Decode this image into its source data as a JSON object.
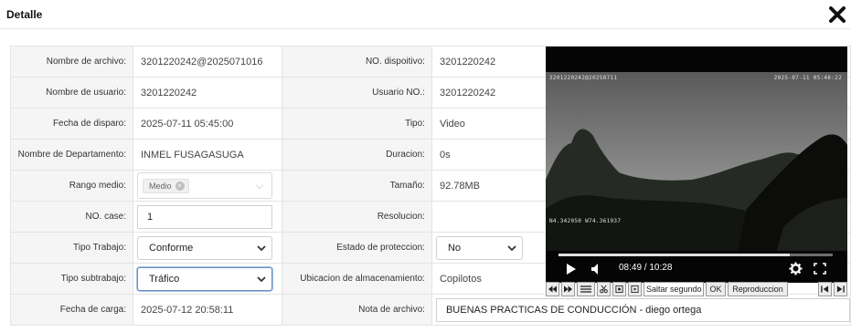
{
  "dialog": {
    "title": "Detalle",
    "close_icon": "close-icon"
  },
  "form": {
    "nombre_archivo": {
      "label": "Nombre de archivo:",
      "value": "3201220242@2025071016"
    },
    "no_dispositivo": {
      "label": "NO. dispoitivo:",
      "value": "3201220242"
    },
    "nombre_usuario": {
      "label": "Nombre de usuario:",
      "value": "3201220242"
    },
    "usuario_no": {
      "label": "Usuario NO.:",
      "value": "3201220242"
    },
    "fecha_disparo": {
      "label": "Fecha de disparo:",
      "value": "2025-07-11 05:45:00"
    },
    "tipo": {
      "label": "Tipo:",
      "value": "Video"
    },
    "nombre_departamento": {
      "label": "Nombre de Departamento:",
      "value": "INMEL FUSAGASUGA"
    },
    "duracion": {
      "label": "Duracion:",
      "value": "0s"
    },
    "rango_medio": {
      "label": "Rango medio:",
      "tag": "Medio"
    },
    "tamano": {
      "label": "Tamaño:",
      "value": "92.78MB"
    },
    "no_case": {
      "label": "NO. case:",
      "value": "1"
    },
    "resolucion": {
      "label": "Resolucion:",
      "value": ""
    },
    "tipo_trabajo": {
      "label": "Tipo Trabajo:",
      "value": "Conforme"
    },
    "estado_proteccion": {
      "label": "Estado de proteccion:",
      "value": "No"
    },
    "tipo_subtrabajo": {
      "label": "Tipo subtrabajo:",
      "value": "Tráfico"
    },
    "ubicacion": {
      "label": "Ubicacion de almacenamiento:",
      "value": "Copilotos"
    },
    "fecha_carga": {
      "label": "Fecha de carga:",
      "value": "2025-07-12 20:58:11"
    },
    "nota_archivo": {
      "label": "Nota de archivo:",
      "value": "BUENAS PRACTICAS DE CONDUCCIÓN - diego ortega"
    }
  },
  "player": {
    "osd_top_left": "3201220242@20250711",
    "osd_top_right": "2025-07-11 05:46:22",
    "osd_bottom_left": "N4.342050 W74.361937",
    "time_display": "08:49 / 10:28",
    "progress": 0.843,
    "buttons": {
      "saltar": "Saltar segundo",
      "ok": "OK",
      "reproduccion": "Reproduccion"
    }
  }
}
